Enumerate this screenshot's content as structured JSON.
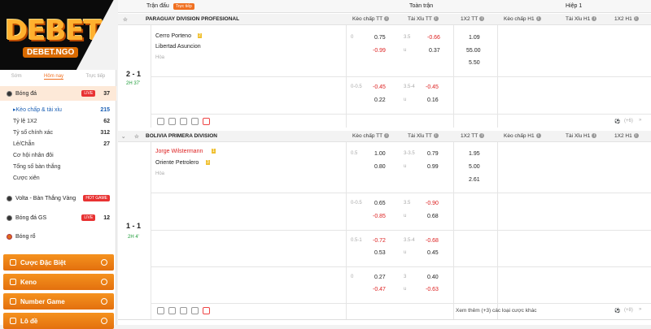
{
  "logo": {
    "text": "DEBET",
    "sub": "DEBET.NGO"
  },
  "sidebar": {
    "tabs": [
      "Sớm",
      "Hôm nay",
      "Trực tiếp"
    ],
    "main": {
      "label": "Bóng đá",
      "live": "LIVE",
      "count": "37"
    },
    "subs": [
      {
        "label": "Kèo chấp & tài xỉu",
        "count": "215"
      },
      {
        "label": "Tỷ lệ 1X2",
        "count": "62"
      },
      {
        "label": "Tỷ số chính xác",
        "count": "312"
      },
      {
        "label": "Lẻ/Chẵn",
        "count": "27"
      },
      {
        "label": "Cơ hội nhân đôi",
        "count": ""
      },
      {
        "label": "Tổng số bàn thắng",
        "count": ""
      },
      {
        "label": "Cược xiên",
        "count": ""
      }
    ],
    "volta": {
      "label": "Volta - Bàn Thắng Vàng",
      "badge": "HOT GAME"
    },
    "gs": {
      "label": "Bóng đá GS",
      "live": "LIVE",
      "count": "12"
    },
    "basket": {
      "label": "Bóng rổ"
    },
    "menu": [
      "Cược Đặc Biệt",
      "Keno",
      "Number Game",
      "Lô đề"
    ]
  },
  "header": {
    "match": "Trận đấu",
    "live_badge": "Trực tiếp",
    "full": "Toàn trận",
    "half": "Hiệp 1"
  },
  "columns": [
    "Kèo chấp TT",
    "Tài Xỉu TT",
    "1X2 TT",
    "Kèo chấp H1",
    "Tài Xỉu H1",
    "1X2 H1"
  ],
  "league1": {
    "name": "PARAGUAY DIVISION PROFESIONAL",
    "home": "Cerro Porteno",
    "away": "Libertad Asuncion",
    "draw": "Hòa",
    "score": "2 - 1",
    "time": "2H 37'",
    "more": "(+6)",
    "r1": {
      "hl": "0",
      "h1": "0.75",
      "h2": "-0.99",
      "tl": "3.5",
      "t1": "-0.66",
      "u": "u",
      "t2": "0.37",
      "x1": "1.09",
      "x2": "55.00",
      "x3": "5.50"
    },
    "r2": {
      "hl": "0-0.5",
      "h1": "-0.45",
      "h2": "0.22",
      "tl": "3.5-4",
      "t1": "-0.45",
      "u": "u",
      "t2": "0.16"
    }
  },
  "league2": {
    "name": "BOLIVIA PRIMERA DIVISION",
    "home": "Jorge Wilstermann",
    "away": "Oriente Petrolero",
    "draw": "Hòa",
    "score": "1 - 1",
    "time": "2H 4'",
    "more": "(+8)",
    "see_more": "Xem thêm (+3) các loại cược khác",
    "r1": {
      "hl": "0.5",
      "h1": "1.00",
      "h2": "0.80",
      "tl": "3-3.5",
      "t1": "0.79",
      "u": "u",
      "t2": "0.99",
      "x1": "1.95",
      "x2": "5.00",
      "x3": "2.61"
    },
    "r2": {
      "hl": "0-0.5",
      "h1": "0.65",
      "h2": "-0.85",
      "tl": "3.5",
      "t1": "-0.90",
      "u": "u",
      "t2": "0.68"
    },
    "r3": {
      "hl": "0.5-1",
      "h1": "-0.72",
      "h2": "0.53",
      "tl": "3.5-4",
      "t1": "-0.68",
      "u": "u",
      "t2": "0.45"
    },
    "r4": {
      "hl": "0",
      "h1": "0.27",
      "h2": "-0.47",
      "tl": "3",
      "t1": "0.40",
      "u": "u",
      "t2": "-0.63"
    }
  }
}
